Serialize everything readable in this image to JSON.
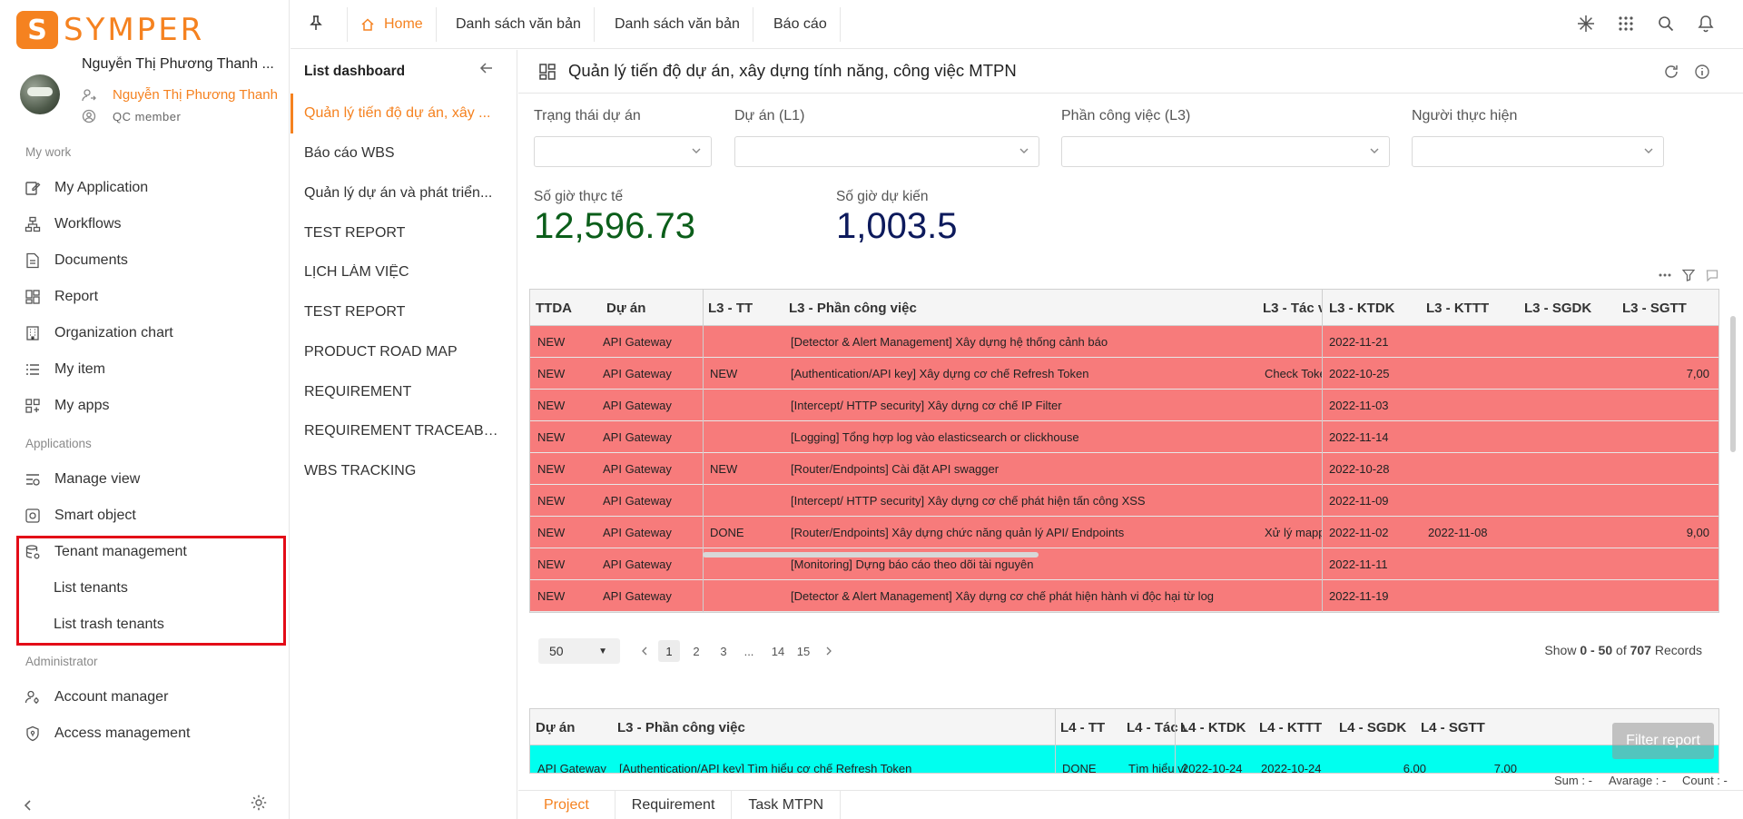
{
  "brand": {
    "name": "SYMPER",
    "mark": "S"
  },
  "profile": {
    "name": "Nguyễn Thị Phương Thanh ...",
    "sub_name": "Nguyễn Thị Phương Thanh",
    "role": "QC member"
  },
  "sidebar": {
    "sections": {
      "my_work": "My work",
      "applications": "Applications",
      "administrator": "Administrator"
    },
    "my_work_items": [
      "My Application",
      "Workflows",
      "Documents",
      "Report",
      "Organization chart",
      "My item",
      "My apps"
    ],
    "application_items": [
      "Manage view",
      "Smart object",
      "Tenant management"
    ],
    "tenant_sub_items": [
      "List tenants",
      "List trash tenants"
    ],
    "admin_items": [
      "Account manager",
      "Access management"
    ]
  },
  "topbar": {
    "tabs": [
      "Home",
      "Danh sách văn bản",
      "Danh sách văn bản",
      "Báo cáo"
    ]
  },
  "list_dashboard": {
    "title": "List dashboard",
    "items": [
      "Quản lý tiến độ dự án, xây ...",
      "Báo cáo WBS",
      "Quản lý dự án và phát triển...",
      "TEST REPORT",
      "LỊCH LÀM VIỆC",
      "TEST REPORT",
      "PRODUCT ROAD MAP",
      "REQUIREMENT",
      "REQUIREMENT TRACEABI...",
      "WBS TRACKING"
    ]
  },
  "main": {
    "title": "Quản lý tiến độ dự án, xây dựng tính năng, công việc MTPN",
    "filters": [
      "Trạng thái dự án",
      "Dự án (L1)",
      "Phần công việc (L3)",
      "Người thực hiện"
    ],
    "kpis": [
      {
        "label": "Số giờ thực tế",
        "value": "12,596.73",
        "color": "#0b5e1a"
      },
      {
        "label": "Số giờ dự kiến",
        "value": "1,003.5",
        "color": "#0d1a5c"
      }
    ]
  },
  "grid": {
    "row_color": "#f77b7b",
    "headers": [
      "TTDA",
      "Dự án",
      "L3 - TT",
      "L3 - Phần công việc",
      "L3 - Tác v",
      "L3 - KTDK",
      "L3 - KTTT",
      "L3 - SGDK",
      "L3 - SGTT"
    ],
    "rows": [
      [
        "NEW",
        "API Gateway",
        "",
        "[Detector & Alert Management] Xây dựng hệ thống cảnh báo",
        "",
        "2022-11-21",
        "",
        "",
        ""
      ],
      [
        "NEW",
        "API Gateway",
        "NEW",
        "[Authentication/API key] Xây dựng cơ chế Refresh Token",
        "Check Toke",
        "2022-10-25",
        "",
        "",
        "7,00"
      ],
      [
        "NEW",
        "API Gateway",
        "",
        "[Intercept/ HTTP security] Xây dựng cơ chế IP Filter",
        "",
        "2022-11-03",
        "",
        "",
        ""
      ],
      [
        "NEW",
        "API Gateway",
        "",
        "[Logging] Tổng hợp log vào elasticsearch or clickhouse",
        "",
        "2022-11-14",
        "",
        "",
        ""
      ],
      [
        "NEW",
        "API Gateway",
        "NEW",
        "[Router/Endpoints] Cài đặt API swagger",
        "",
        "2022-10-28",
        "",
        "",
        ""
      ],
      [
        "NEW",
        "API Gateway",
        "",
        "[Intercept/ HTTP security] Xây dựng cơ chế phát hiện tấn công XSS",
        "",
        "2022-11-09",
        "",
        "",
        ""
      ],
      [
        "NEW",
        "API Gateway",
        "DONE",
        "[Router/Endpoints] Xây dựng chức năng quản lý API/ Endpoints",
        "Xử lý mappi",
        "2022-11-02",
        "2022-11-08",
        "",
        "9,00"
      ],
      [
        "NEW",
        "API Gateway",
        "",
        "[Monitoring] Dựng báo cáo theo dõi tài nguyên",
        "",
        "2022-11-11",
        "",
        "",
        ""
      ],
      [
        "NEW",
        "API Gateway",
        "",
        "[Detector & Alert Management] Xây dựng cơ chế phát hiện hành vi độc hại từ log",
        "",
        "2022-11-19",
        "",
        "",
        ""
      ]
    ],
    "page_size": "50",
    "pages": [
      "1",
      "2",
      "3",
      "...",
      "14",
      "15"
    ],
    "records": {
      "prefix": "Show",
      "range": "0 - 50",
      "of": "of",
      "total": "707",
      "suffix": "Records"
    }
  },
  "grid2": {
    "row_color": "#00ffef",
    "headers": [
      "Dự án",
      "L3 - Phần công việc",
      "L4 - TT",
      "L4 - Tác v",
      "L4 - KTDK",
      "L4 - KTTT",
      "L4 - SGDK",
      "L4 - SGTT"
    ],
    "row": [
      "API Gateway",
      "[Authentication/API key] Tìm hiểu cơ chế Refresh Token",
      "DONE",
      "Tìm hiểu về",
      "2022-10-24",
      "2022-10-24",
      "6,00",
      "7,00"
    ]
  },
  "filter_report_label": "Filter report",
  "summary": {
    "sum": "Sum : -",
    "average": "Avarage : -",
    "count": "Count : -"
  },
  "bottom_tabs": [
    "Project",
    "Requirement",
    "Task MTPN"
  ]
}
